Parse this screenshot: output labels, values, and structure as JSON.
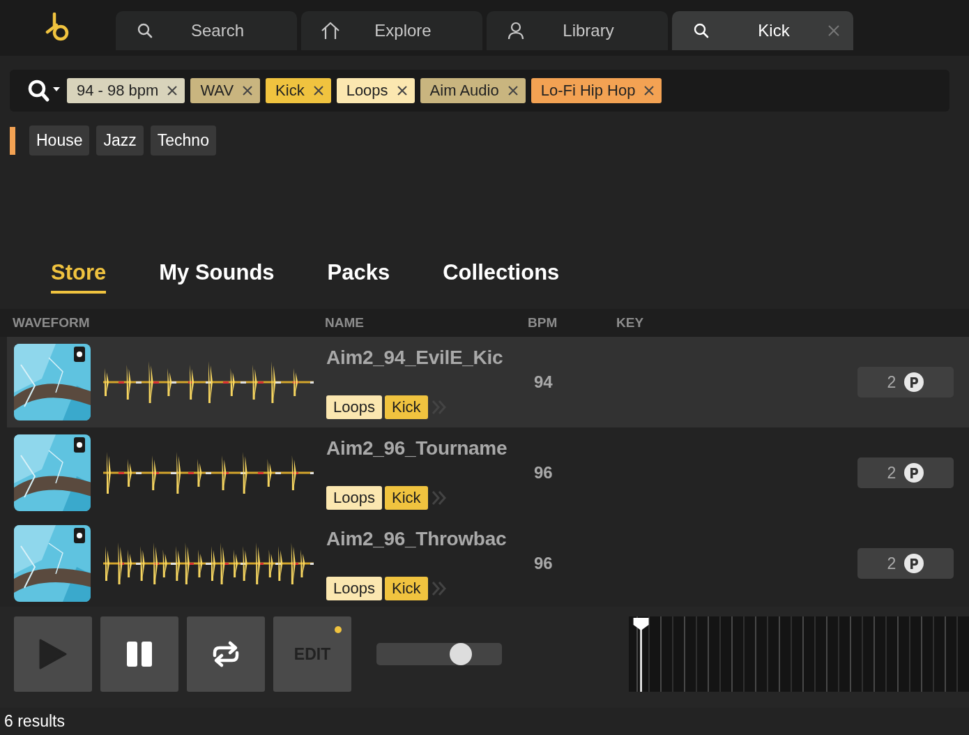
{
  "nav_tabs": [
    {
      "kind": "search",
      "label": "Search",
      "selected": false,
      "closable": false
    },
    {
      "kind": "home",
      "label": "Explore",
      "selected": false,
      "closable": false
    },
    {
      "kind": "person",
      "label": "Library",
      "selected": false,
      "closable": false
    },
    {
      "kind": "search",
      "label": "Kick",
      "selected": true,
      "closable": true
    }
  ],
  "filters": [
    {
      "label": "94 - 98 bpm",
      "color": "#d8d3bb"
    },
    {
      "label": "WAV",
      "color": "#c9b57f"
    },
    {
      "label": "Kick",
      "color": "#f0c33f"
    },
    {
      "label": "Loops",
      "color": "#fbe7b0"
    },
    {
      "label": "Aim Audio",
      "color": "#c9b57f"
    },
    {
      "label": "Lo-Fi Hip Hop",
      "color": "#f3a253"
    }
  ],
  "genres": [
    "House",
    "Jazz",
    "Techno"
  ],
  "section_tabs": [
    {
      "label": "Store",
      "selected": true
    },
    {
      "label": "My Sounds",
      "selected": false
    },
    {
      "label": "Packs",
      "selected": false
    },
    {
      "label": "Collections",
      "selected": false
    }
  ],
  "columns": [
    "WAVEFORM",
    "NAME",
    "BPM",
    "KEY"
  ],
  "rows": [
    {
      "name": "Aim2_94_EvilE_Kic",
      "bpm": "94",
      "credits": "2",
      "selected": true,
      "tags": [
        {
          "label": "Loops",
          "color": "#fbe7b0"
        },
        {
          "label": "Kick",
          "color": "#f0c33f"
        }
      ]
    },
    {
      "name": "Aim2_96_Tourname",
      "bpm": "96",
      "credits": "2",
      "selected": false,
      "tags": [
        {
          "label": "Loops",
          "color": "#fbe7b0"
        },
        {
          "label": "Kick",
          "color": "#f0c33f"
        }
      ]
    },
    {
      "name": "Aim2_96_Throwbac",
      "bpm": "96",
      "credits": "2",
      "selected": false,
      "tags": [
        {
          "label": "Loops",
          "color": "#fbe7b0"
        },
        {
          "label": "Kick",
          "color": "#f0c33f"
        }
      ]
    }
  ],
  "player": {
    "edit_label": "EDIT",
    "edit_modified": true,
    "volume": {
      "level": 0.67
    },
    "timeline": {
      "level": 0.036
    }
  },
  "status": "6 results"
}
